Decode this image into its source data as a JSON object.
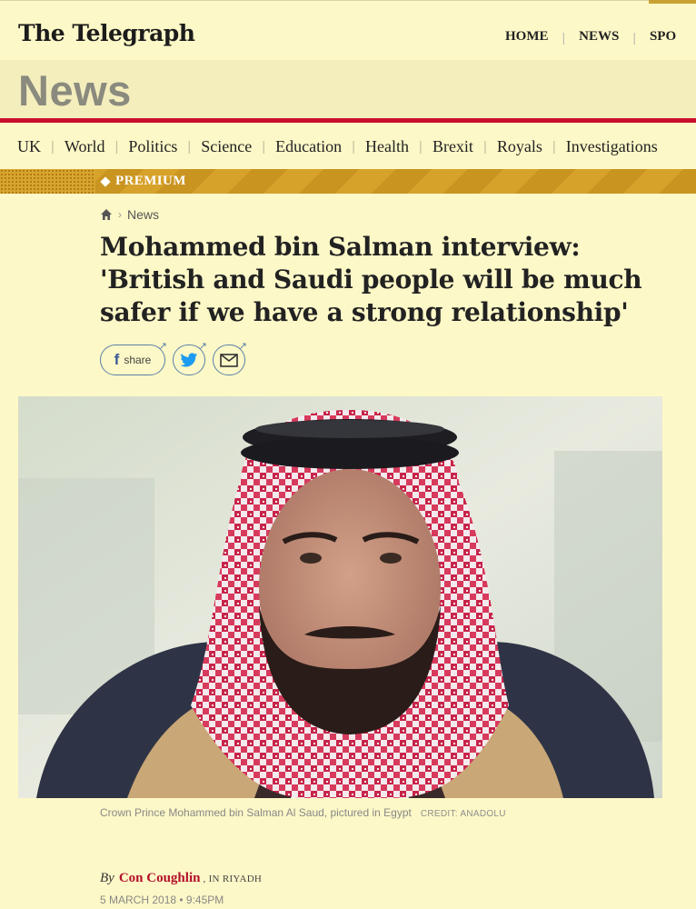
{
  "masthead": {
    "logo": "The Telegraph"
  },
  "top_nav": {
    "items": [
      "HOME",
      "NEWS",
      "SPO"
    ]
  },
  "section": {
    "title": "News"
  },
  "sub_nav": {
    "items": [
      "UK",
      "World",
      "Politics",
      "Science",
      "Education",
      "Health",
      "Brexit",
      "Royals",
      "Investigations"
    ]
  },
  "premium": {
    "label": "PREMIUM"
  },
  "breadcrumb": {
    "icon": "home-icon",
    "current": "News"
  },
  "article": {
    "headline": "Mohammed bin Salman interview: 'British and Saudi people will be much safer if we have a strong relationship'",
    "share": {
      "facebook_label": "share",
      "icons": [
        "facebook-icon",
        "twitter-icon",
        "email-icon"
      ]
    },
    "image": {
      "caption": "Crown Prince Mohammed bin Salman Al Saud, pictured in Egypt",
      "credit": "CREDIT: ANADOLU"
    },
    "byline": {
      "prefix": "By",
      "author": "Con Coughlin",
      "location": "IN RIYADH"
    },
    "date": "5 MARCH 2018 • 9:45PM"
  },
  "colors": {
    "background": "#fdf8c7",
    "accent_red": "#c8102e",
    "premium_gold": "#d7a22a",
    "link_red": "#b3102a"
  }
}
